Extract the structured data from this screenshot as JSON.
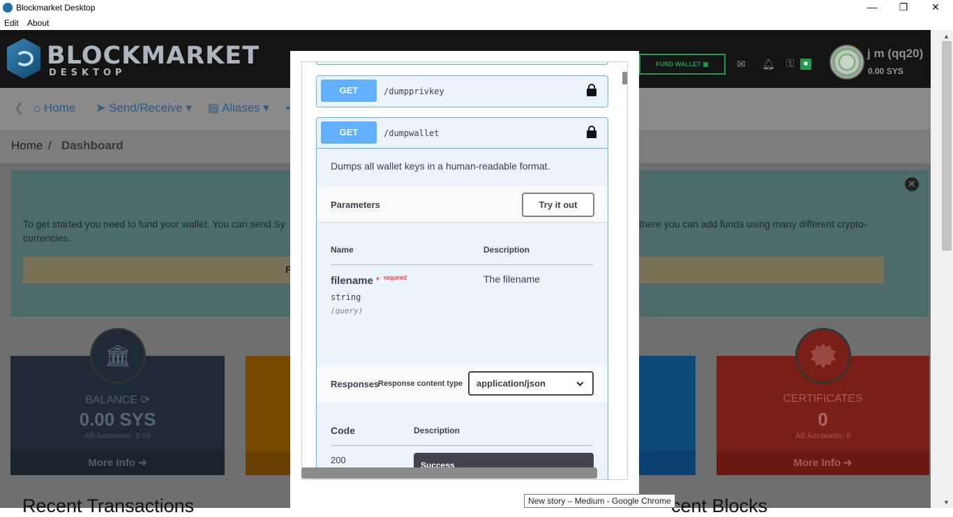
{
  "window": {
    "title": "Blockmarket Desktop",
    "minimize": "—",
    "restore": "❐",
    "close": "✕"
  },
  "menu": {
    "edit": "Edit",
    "about": "About"
  },
  "header": {
    "logo_main": "BLOCKMARKET",
    "logo_sub": "DESKTOP",
    "fund_wallet": "FUND WALLET",
    "username": "j m (qq20)",
    "balance": "0.00 SYS"
  },
  "nav": {
    "home": "Home",
    "send_receive": "Send/Receive",
    "aliases": "Aliases"
  },
  "breadcrumb": {
    "home": "Home",
    "separator": "/",
    "current": "Dashboard"
  },
  "alert": {
    "line1_left": "To get started you need to fund your wallet. You can send Sy",
    "line1_right": "there you can add funds using many different crypto-",
    "line2": "currencies.",
    "inner_letter": "P"
  },
  "cards": {
    "balance": {
      "title": "BALANCE",
      "value": "0.00 SYS",
      "sub": "All Accounts: 0.00",
      "footer": "More Info"
    },
    "certificates": {
      "title": "CERTIFICATES",
      "value": "0",
      "sub": "All Accounts: 0",
      "footer": "More Info"
    }
  },
  "sections": {
    "recent_transactions": "Recent Transactions",
    "recent_blocks": "cent Blocks"
  },
  "swagger": {
    "op1": {
      "method": "GET",
      "path": "/dumpprivkey"
    },
    "op2": {
      "method": "GET",
      "path": "/dumpwallet",
      "description": "Dumps all wallet keys in a human-readable format.",
      "parameters_label": "Parameters",
      "try_it_out": "Try it out",
      "col_name": "Name",
      "col_description": "Description",
      "param_name": "filename",
      "param_required_star": "*",
      "param_required": "required",
      "param_type": "string",
      "param_in": "(query)",
      "param_description": "The filename",
      "responses_label": "Responses",
      "response_content_type_label": "Response content type",
      "response_content_type": "application/json",
      "col_code": "Code",
      "col_resp_description": "Description",
      "code_200": "200",
      "success": "Success"
    }
  },
  "tooltip": "New story – Medium - Google Chrome",
  "colors": {
    "get_method": "#61affe",
    "header_bg": "#141414",
    "fund_green": "#1f9e4a",
    "cert_red": "#c0392b"
  }
}
